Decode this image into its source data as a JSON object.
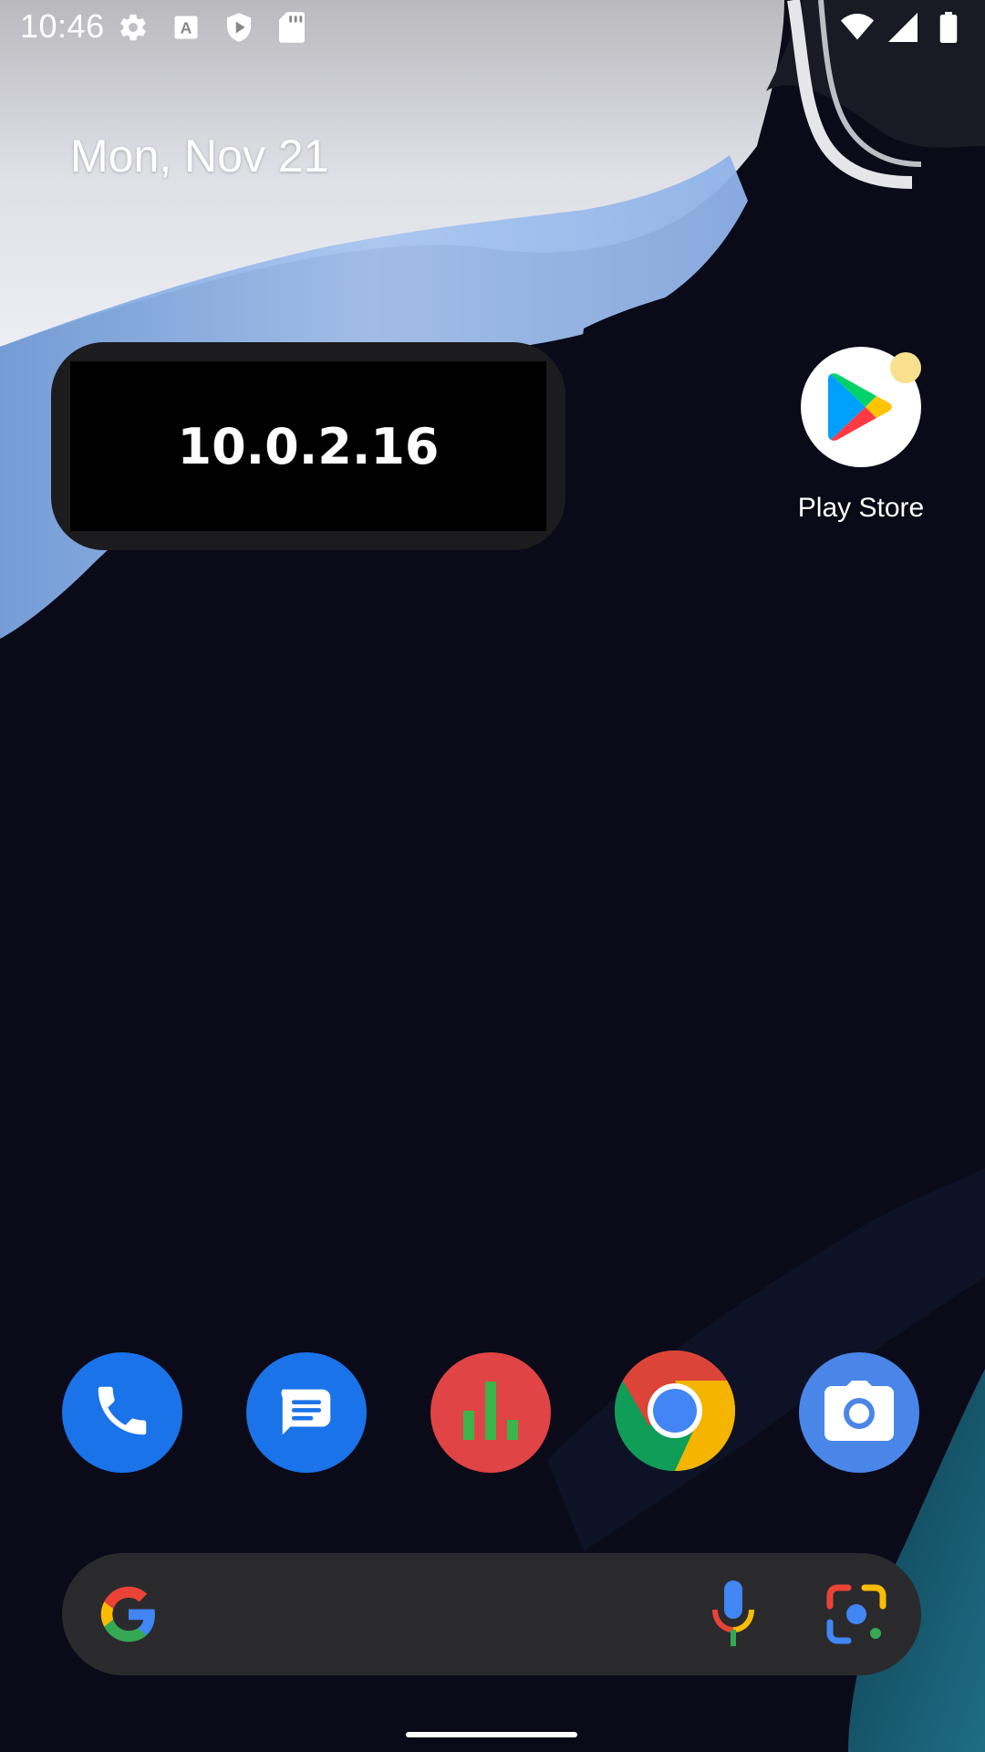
{
  "status_bar": {
    "time": "10:46",
    "left_icons": [
      "settings-icon",
      "font-a-icon",
      "shield-play-icon",
      "sd-card-icon"
    ],
    "right_icons": [
      "wifi-icon",
      "cell-signal-icon",
      "battery-icon"
    ]
  },
  "home": {
    "date": "Mon, Nov 21",
    "ip_widget": {
      "text": "10.0.2.16"
    },
    "apps": [
      {
        "label": "Play Store",
        "icon": "play-store-icon",
        "has_notification_dot": true
      }
    ]
  },
  "dock": {
    "apps": [
      {
        "name": "phone",
        "icon": "phone-icon",
        "color": "#1a73e8"
      },
      {
        "name": "messages",
        "icon": "messages-icon",
        "color": "#1a73e8"
      },
      {
        "name": "stats",
        "icon": "bar-chart-icon",
        "color": "#e04444"
      },
      {
        "name": "chrome",
        "icon": "chrome-icon",
        "color": "#34a853"
      },
      {
        "name": "camera",
        "icon": "camera-icon",
        "color": "#4a86e8"
      }
    ]
  },
  "search": {
    "icons": [
      "google-g-icon",
      "microphone-icon",
      "google-lens-icon"
    ]
  },
  "colors": {
    "wallpaper_dark": "#0a0a18",
    "wallpaper_blue": "#9cbdf0",
    "search_bg": "#2a2a2d",
    "widget_bg": "#000000"
  }
}
